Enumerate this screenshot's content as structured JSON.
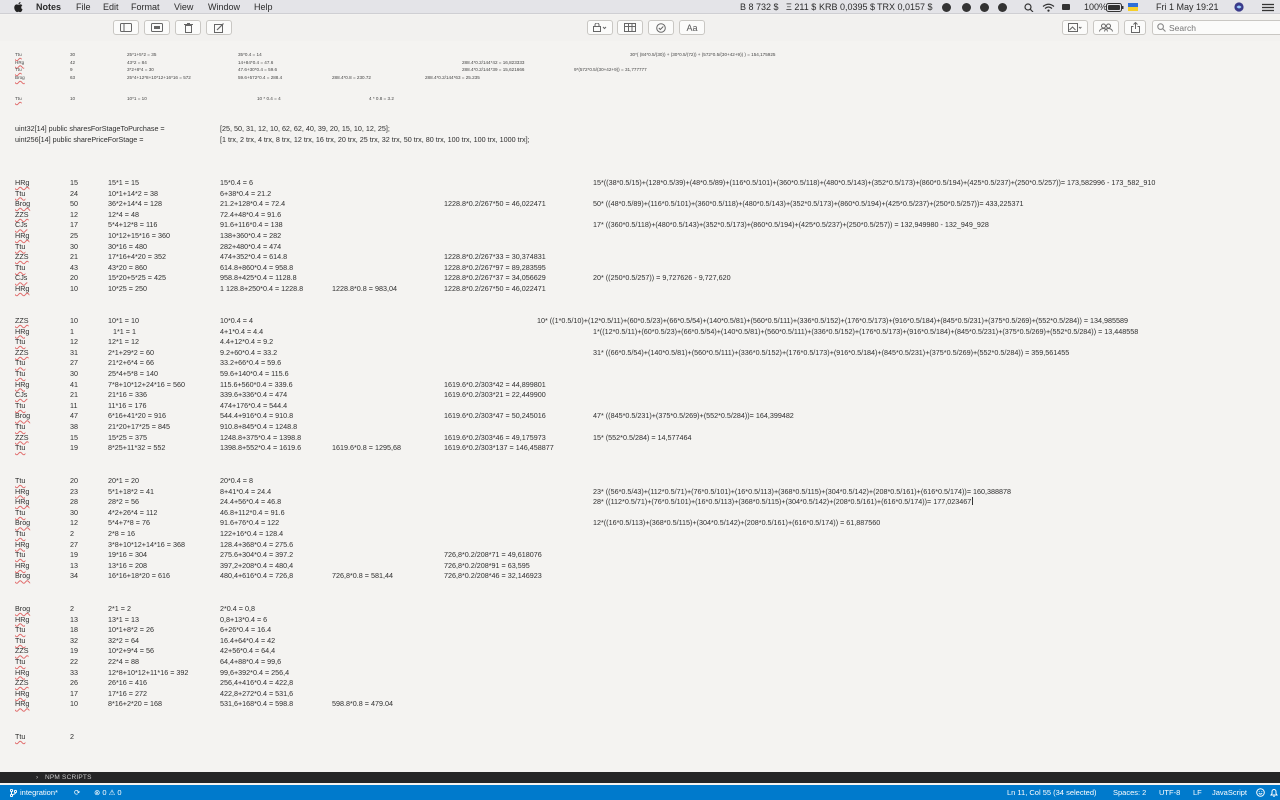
{
  "menubar": {
    "app": "Notes",
    "items": [
      "File",
      "Edit",
      "Format",
      "View",
      "Window",
      "Help"
    ],
    "tickers": [
      "B 8 732 $",
      "Ξ 211 $",
      "KRB 0,0395 $",
      "TRX 0,0157 $"
    ],
    "battery": "100%",
    "clock": "Fri 1 May  19:21",
    "search_placeholder": "Search"
  },
  "toolbar": {
    "format_label": "Aa",
    "icons": [
      "sidebar-icon",
      "gallery-icon",
      "trash-icon",
      "compose-icon",
      "lock-icon",
      "table-icon",
      "checklist-icon",
      "format-icon",
      "media-icon",
      "collaborate-icon",
      "share-icon",
      "search-icon"
    ]
  },
  "note": {
    "small_block": [
      {
        "name": "Ttu",
        "n": "30",
        "a": "25*1+5*2 = 35",
        "b": "35*0.4 = 14",
        "c": "",
        "d": "",
        "e": "30*( (84*0.5/(30)) + (30*0.5/(72)) + (572*0.5/(30+42+9)) ) = 154,175925"
      },
      {
        "name": "HRg",
        "n": "42",
        "a": "43*2 = 84",
        "b": "14+84*0.4 = 47.6",
        "c": "",
        "d": "288.4*0.2/144*42 = 16,823333",
        "e": ""
      },
      {
        "name": "Ttu",
        "n": "9",
        "a": "3*2+8*4 = 30",
        "b": "47.6+30*0.4 = 59.6",
        "c": "",
        "d": "288.4*0.2/144*39 = 15,621666",
        "e": "9*(572*0.5/(30+42+9)) = 31,777777"
      },
      {
        "name": "Brog",
        "n": "63",
        "a": "25*4+12*8+10*12+16*16 = 572",
        "b": "59.6+572*0.4 = 288.4",
        "c": "288.4*0.8 = 230.72",
        "d": "288.4*0.2/144*63 = 25.235",
        "e": ""
      },
      {
        "name": "Ttu",
        "n": "10",
        "a": "10*1 = 10",
        "b": "10 * 0.4 = 4",
        "c": "4 * 0.8 = 3.2",
        "d": "",
        "e": ""
      }
    ],
    "code_lines": [
      {
        "left": "uint32[14] public sharesForStageToPurchase =",
        "right": "[25,     50,     31,     12,     10,       62,      62,      40,       39,      20,       15,       10,         12,          25];"
      },
      {
        "left": "uint256[14] public sharePriceForStage =",
        "right": "[1 trx, 2 trx, 4 trx, 8 trx, 12 trx, 16 trx, 20 trx, 25 trx, 32 trx, 50 trx, 80 trx, 100 trx, 100 trx, 1000 trx];"
      }
    ],
    "block1": [
      {
        "name": "HRg",
        "n": "15",
        "a": "15*1 = 15",
        "b": "15*0.4 = 6",
        "c": "",
        "d": "",
        "e": "15*((38*0.5/15)+(128*0.5/39)+(48*0.5/89)+(116*0.5/101)+(360*0.5/118)+(480*0.5/143)+(352*0.5/173)+(860*0.5/194)+(425*0.5/237)+(250*0.5/257))= 173,582996 - 173_582_910"
      },
      {
        "name": "Ttu",
        "n": "24",
        "a": "10*1+14*2 = 38",
        "b": "6+38*0.4 = 21.2",
        "c": "",
        "d": "",
        "e": ""
      },
      {
        "name": "Brog",
        "n": "50",
        "a": "36*2+14*4 = 128",
        "b": "21.2+128*0.4 = 72.4",
        "c": "",
        "d": "1228.8*0.2/267*50 = 46,022471",
        "e": "50* ((48*0.5/89)+(116*0.5/101)+(360*0.5/118)+(480*0.5/143)+(352*0.5/173)+(860*0.5/194)+(425*0.5/237)+(250*0.5/257))= 433,225371"
      },
      {
        "name": "ZZS",
        "n": "12",
        "a": "12*4 = 48",
        "b": "72.4+48*0.4 = 91.6",
        "c": "",
        "d": "",
        "e": ""
      },
      {
        "name": "CJs",
        "n": "17",
        "a": "5*4+12*8 = 116",
        "b": "91.6+116*0.4 = 138",
        "c": "",
        "d": "",
        "e": "17* ((360*0.5/118)+(480*0.5/143)+(352*0.5/173)+(860*0.5/194)+(425*0.5/237)+(250*0.5/257)) = 132,949980 - 132_949_928"
      },
      {
        "name": "HRg",
        "n": "25",
        "a": "10*12+15*16 = 360",
        "b": "138+360*0.4 = 282",
        "c": "",
        "d": "",
        "e": ""
      },
      {
        "name": "Ttu",
        "n": "30",
        "a": "30*16 = 480",
        "b": "282+480*0.4 = 474",
        "c": "",
        "d": "",
        "e": ""
      },
      {
        "name": "ZZS",
        "n": "21",
        "a": "17*16+4*20 = 352",
        "b": "474+352*0.4 = 614.8",
        "c": "",
        "d": "1228.8*0.2/267*33 = 30,374831",
        "e": ""
      },
      {
        "name": "Ttu",
        "n": "43",
        "a": "43*20 = 860",
        "b": "614.8+860*0.4 = 958.8",
        "c": "",
        "d": "1228.8*0.2/267*97 = 89,283595",
        "e": ""
      },
      {
        "name": "CJs",
        "n": "20",
        "a": "15*20+5*25 = 425",
        "b": "958.8+425*0.4 = 1128.8",
        "c": "",
        "d": "1228.8*0.2/267*37 = 34,056629",
        "e": "20* ((250*0.5/257)) = 9,727626 - 9,727,620"
      },
      {
        "name": "HRg",
        "n": "10",
        "a": "10*25 = 250",
        "b": "1 128.8+250*0.4 = 1228.8",
        "c": "1228.8*0.8 = 983,04",
        "d": "1228.8*0.2/267*50 = 46,022471",
        "e": ""
      }
    ],
    "block2": [
      {
        "name": "ZZS",
        "n": "10",
        "a": "10*1 = 10",
        "b": "10*0.4 = 4",
        "c": "",
        "d": "",
        "e": "10* ((1*0.5/10)+(12*0.5/11)+(60*0.5/23)+(66*0.5/54)+(140*0.5/81)+(560*0.5/111)+(336*0.5/152)+(176*0.5/173)+(916*0.5/184)+(845*0.5/231)+(375*0.5/269)+(552*0.5/284)) = 134,985589"
      },
      {
        "name": "HRg",
        "n": "1",
        "a": "1*1 = 1",
        "b": "4+1*0.4 = 4.4",
        "c": "",
        "d": "",
        "e": "1*((12*0.5/11)+(60*0.5/23)+(66*0.5/54)+(140*0.5/81)+(560*0.5/111)+(336*0.5/152)+(176*0.5/173)+(916*0.5/184)+(845*0.5/231)+(375*0.5/269)+(552*0.5/284)) = 13,448558"
      },
      {
        "name": "Ttu",
        "n": "12",
        "a": "12*1 = 12",
        "b": "4.4+12*0.4 = 9.2",
        "c": "",
        "d": "",
        "e": ""
      },
      {
        "name": "ZZS",
        "n": "31",
        "a": "2*1+29*2 = 60",
        "b": "9.2+60*0.4 = 33.2",
        "c": "",
        "d": "",
        "e": "31* ((66*0.5/54)+(140*0.5/81)+(560*0.5/111)+(336*0.5/152)+(176*0.5/173)+(916*0.5/184)+(845*0.5/231)+(375*0.5/269)+(552*0.5/284)) = 359,561455"
      },
      {
        "name": "Ttu",
        "n": "27",
        "a": "21*2+6*4 = 66",
        "b": "33.2+66*0.4 = 59.6",
        "c": "",
        "d": "",
        "e": ""
      },
      {
        "name": "Ttu",
        "n": "30",
        "a": "25*4+5*8 = 140",
        "b": "59.6+140*0.4 = 115.6",
        "c": "",
        "d": "",
        "e": ""
      },
      {
        "name": "HRg",
        "n": "41",
        "a": "7*8+10*12+24*16 = 560",
        "b": "115.6+560*0.4 = 339.6",
        "c": "",
        "d": "1619.6*0.2/303*42 = 44,899801",
        "e": ""
      },
      {
        "name": "CJs",
        "n": "21",
        "a": "21*16 = 336",
        "b": "339.6+336*0.4 = 474",
        "c": "",
        "d": "1619.6*0.2/303*21 =  22,449900",
        "e": ""
      },
      {
        "name": "Ttu",
        "n": "11",
        "a": "11*16 = 176",
        "b": "474+176*0.4 = 544.4",
        "c": "",
        "d": "",
        "e": ""
      },
      {
        "name": "Brog",
        "n": "47",
        "a": "6*16+41*20 = 916",
        "b": "544.4+916*0.4 = 910.8",
        "c": "",
        "d": "1619.6*0.2/303*47 = 50,245016",
        "e": "47* ((845*0.5/231)+(375*0.5/269)+(552*0.5/284))= 164,399482"
      },
      {
        "name": "Ttu",
        "n": "38",
        "a": "21*20+17*25 = 845",
        "b": "910.8+845*0.4 = 1248.8",
        "c": "",
        "d": "",
        "e": ""
      },
      {
        "name": "ZZS",
        "n": "15",
        "a": "15*25 = 375",
        "b": "1248.8+375*0.4 = 1398.8",
        "c": "",
        "d": "1619.6*0.2/303*46 =    49,175973",
        "e": "15* (552*0.5/284) = 14,577464"
      },
      {
        "name": "Ttu",
        "n": "19",
        "a": "8*25+11*32 = 552",
        "b": "1398.8+552*0.4 = 1619.6",
        "c": "1619.6*0.8 = 1295,68",
        "d": "1619.6*0.2/303*137 = 146,458877",
        "e": ""
      }
    ],
    "block3": [
      {
        "name": "Ttu",
        "n": "20",
        "a": "20*1 = 20",
        "b": "20*0.4 = 8",
        "c": "",
        "d": "",
        "e": ""
      },
      {
        "name": "HRg",
        "n": "23",
        "a": "5*1+18*2 = 41",
        "b": "8+41*0.4 = 24.4",
        "c": "",
        "d": "",
        "e": "23* ((56*0.5/43)+(112*0.5/71)+(76*0.5/101)+(16*0.5/113)+(368*0.5/115)+(304*0.5/142)+(208*0.5/161)+(616*0.5/174))= 160,388878"
      },
      {
        "name": "HRg",
        "n": "28",
        "a": "28*2 = 56",
        "b": "24.4+56*0.4 = 46.8",
        "c": "",
        "d": "",
        "e": "28* ((112*0.5/71)+(76*0.5/101)+(16*0.5/113)+(368*0.5/115)+(304*0.5/142)+(208*0.5/161)+(616*0.5/174))=  177,023467"
      },
      {
        "name": "Ttu",
        "n": "30",
        "a": "4*2+26*4 = 112",
        "b": "46.8+112*0.4 = 91.6",
        "c": "",
        "d": "",
        "e": ""
      },
      {
        "name": "Brog",
        "n": "12",
        "a": "5*4+7*8 = 76",
        "b": "91.6+76*0.4 = 122",
        "c": "",
        "d": "",
        "e": "12*((16*0.5/113)+(368*0.5/115)+(304*0.5/142)+(208*0.5/161)+(616*0.5/174)) = 61,887560"
      },
      {
        "name": "Ttu",
        "n": "2",
        "a": "2*8 = 16",
        "b": "122+16*0.4 = 128.4",
        "c": "",
        "d": "",
        "e": ""
      },
      {
        "name": "HRg",
        "n": "27",
        "a": "3*8+10*12+14*16 = 368",
        "b": "128.4+368*0.4 = 275.6",
        "c": "",
        "d": "",
        "e": ""
      },
      {
        "name": "Ttu",
        "n": "19",
        "a": "19*16 = 304",
        "b": "275.6+304*0.4 = 397.2",
        "c": "",
        "d": "726,8*0.2/208*71 = 49,618076",
        "e": ""
      },
      {
        "name": "HRg",
        "n": "13",
        "a": "13*16 = 208",
        "b": "397,2+208*0.4 = 480,4",
        "c": "",
        "d": "726,8*0.2/208*91 = 63,595",
        "e": ""
      },
      {
        "name": "Brog",
        "n": "34",
        "a": "16*16+18*20 = 616",
        "b": "480,4+616*0.4 = 726,8",
        "c": "726,8*0.8 = 581,44",
        "d": "726,8*0.2/208*46 = 32,146923",
        "e": ""
      }
    ],
    "block4": [
      {
        "name": "Brog",
        "n": "2",
        "a": "2*1 = 2",
        "b": "2*0.4 = 0,8",
        "c": "",
        "d": "",
        "e": ""
      },
      {
        "name": "HRg",
        "n": "13",
        "a": "13*1 = 13",
        "b": "0,8+13*0.4 = 6",
        "c": "",
        "d": "",
        "e": ""
      },
      {
        "name": "Ttu",
        "n": "18",
        "a": "10*1+8*2 = 26",
        "b": "6+26*0.4 = 16.4",
        "c": "",
        "d": "",
        "e": ""
      },
      {
        "name": "Ttu",
        "n": "32",
        "a": "32*2 = 64",
        "b": "16.4+64*0.4 = 42",
        "c": "",
        "d": "",
        "e": ""
      },
      {
        "name": "ZZS",
        "n": "19",
        "a": "10*2+9*4 = 56",
        "b": "42+56*0.4 = 64,4",
        "c": "",
        "d": "",
        "e": ""
      },
      {
        "name": "Ttu",
        "n": "22",
        "a": "22*4 = 88",
        "b": "64,4+88*0.4 = 99,6",
        "c": "",
        "d": "",
        "e": ""
      },
      {
        "name": "HRg",
        "n": "33",
        "a": "12*8+10*12+11*16 = 392",
        "b": "99,6+392*0.4 = 256,4",
        "c": "",
        "d": "",
        "e": ""
      },
      {
        "name": "ZZS",
        "n": "26",
        "a": "26*16 = 416",
        "b": "256,4+416*0.4 = 422,8",
        "c": "",
        "d": "",
        "e": ""
      },
      {
        "name": "HRg",
        "n": "17",
        "a": "17*16 = 272",
        "b": "422,8+272*0.4 = 531,6",
        "c": "",
        "d": "",
        "e": ""
      },
      {
        "name": "HRg",
        "n": "10",
        "a": "8*16+2*20 = 168",
        "b": "531,6+168*0.4 = 598.8",
        "c": "598.8*0.8 = 479.04",
        "d": "",
        "e": ""
      }
    ],
    "last_line": {
      "name": "Ttu",
      "n": "2"
    }
  },
  "npm_scripts": {
    "chevron": "›",
    "label": "NPM SCRIPTS"
  },
  "statusbar": {
    "branch": "integration*",
    "sync": "⟳",
    "problems": "⊗ 0 ⚠ 0",
    "position": "Ln 11, Col 55 (34 selected)",
    "spaces": "Spaces: 2",
    "encoding": "UTF-8",
    "eol": "LF",
    "language": "JavaScript"
  }
}
